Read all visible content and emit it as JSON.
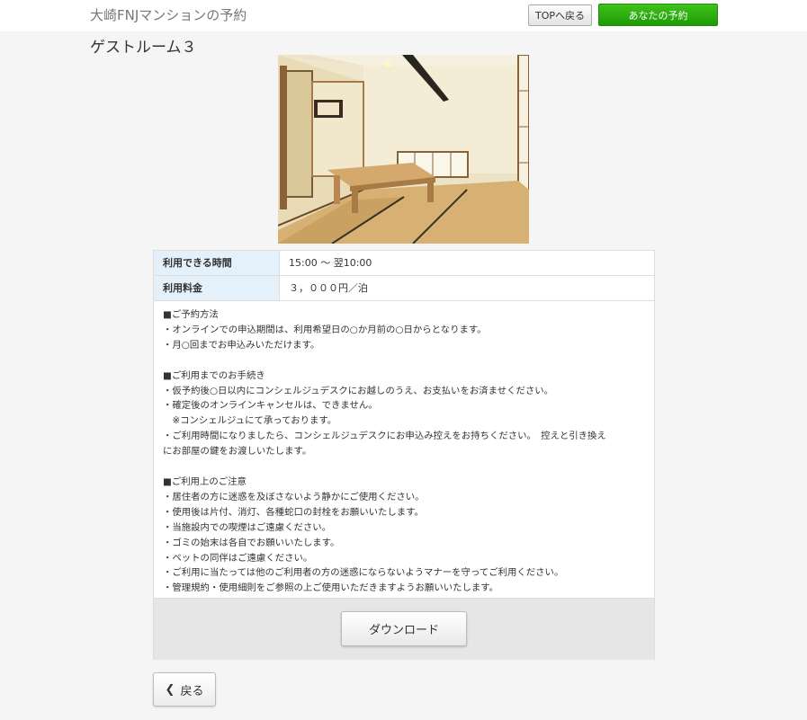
{
  "header": {
    "site_title": "大崎FNJマンションの予約",
    "top_button_label": "TOPへ戻る",
    "my_reservation_button_label": "あなたの予約"
  },
  "page": {
    "title": "ゲストルーム３"
  },
  "details": {
    "rows": [
      {
        "label": "利用できる時間",
        "value": "15:00 ～ 翌10:00"
      },
      {
        "label": "利用料金",
        "value": "３，０００円／泊"
      }
    ],
    "notes": "■ご予約方法\n・オンラインでの申込期間は、利用希望日の○か月前の○日からとなります。\n・月○回までお申込みいただけます。\n\n■ご利用までのお手続き\n・仮予約後○日以内にコンシェルジュデスクにお越しのうえ、お支払いをお済ませください。\n・確定後のオンラインキャンセルは、できません。\n　※コンシェルジュにて承っております。\n・ご利用時間になりましたら、コンシェルジュデスクにお申込み控えをお持ちください。　控えと引き換え\nにお部屋の鍵をお渡しいたします。\n\n■ご利用上のご注意\n・居住者の方に迷惑を及ぼさないよう静かにご使用ください。\n・使用後は片付、消灯、各種蛇口の封栓をお願いいたします。\n・当施設内での喫煙はご遠慮ください。\n・ゴミの始末は各自でお願いいたします。\n・ペットの同伴はご遠慮ください。\n・ご利用に当たっては他のご利用者の方の迷惑にならないようマナーを守ってご利用ください。\n・管理規約・使用細則をご参照の上ご使用いただきますようお願いいたします。"
  },
  "actions": {
    "download_label": "ダウンロード",
    "back_label": "戻る"
  },
  "icons": {
    "back": "chevron-left-icon"
  },
  "colors": {
    "accent_green": "#1e9b06",
    "label_cell_bg": "#e4f1fb"
  }
}
